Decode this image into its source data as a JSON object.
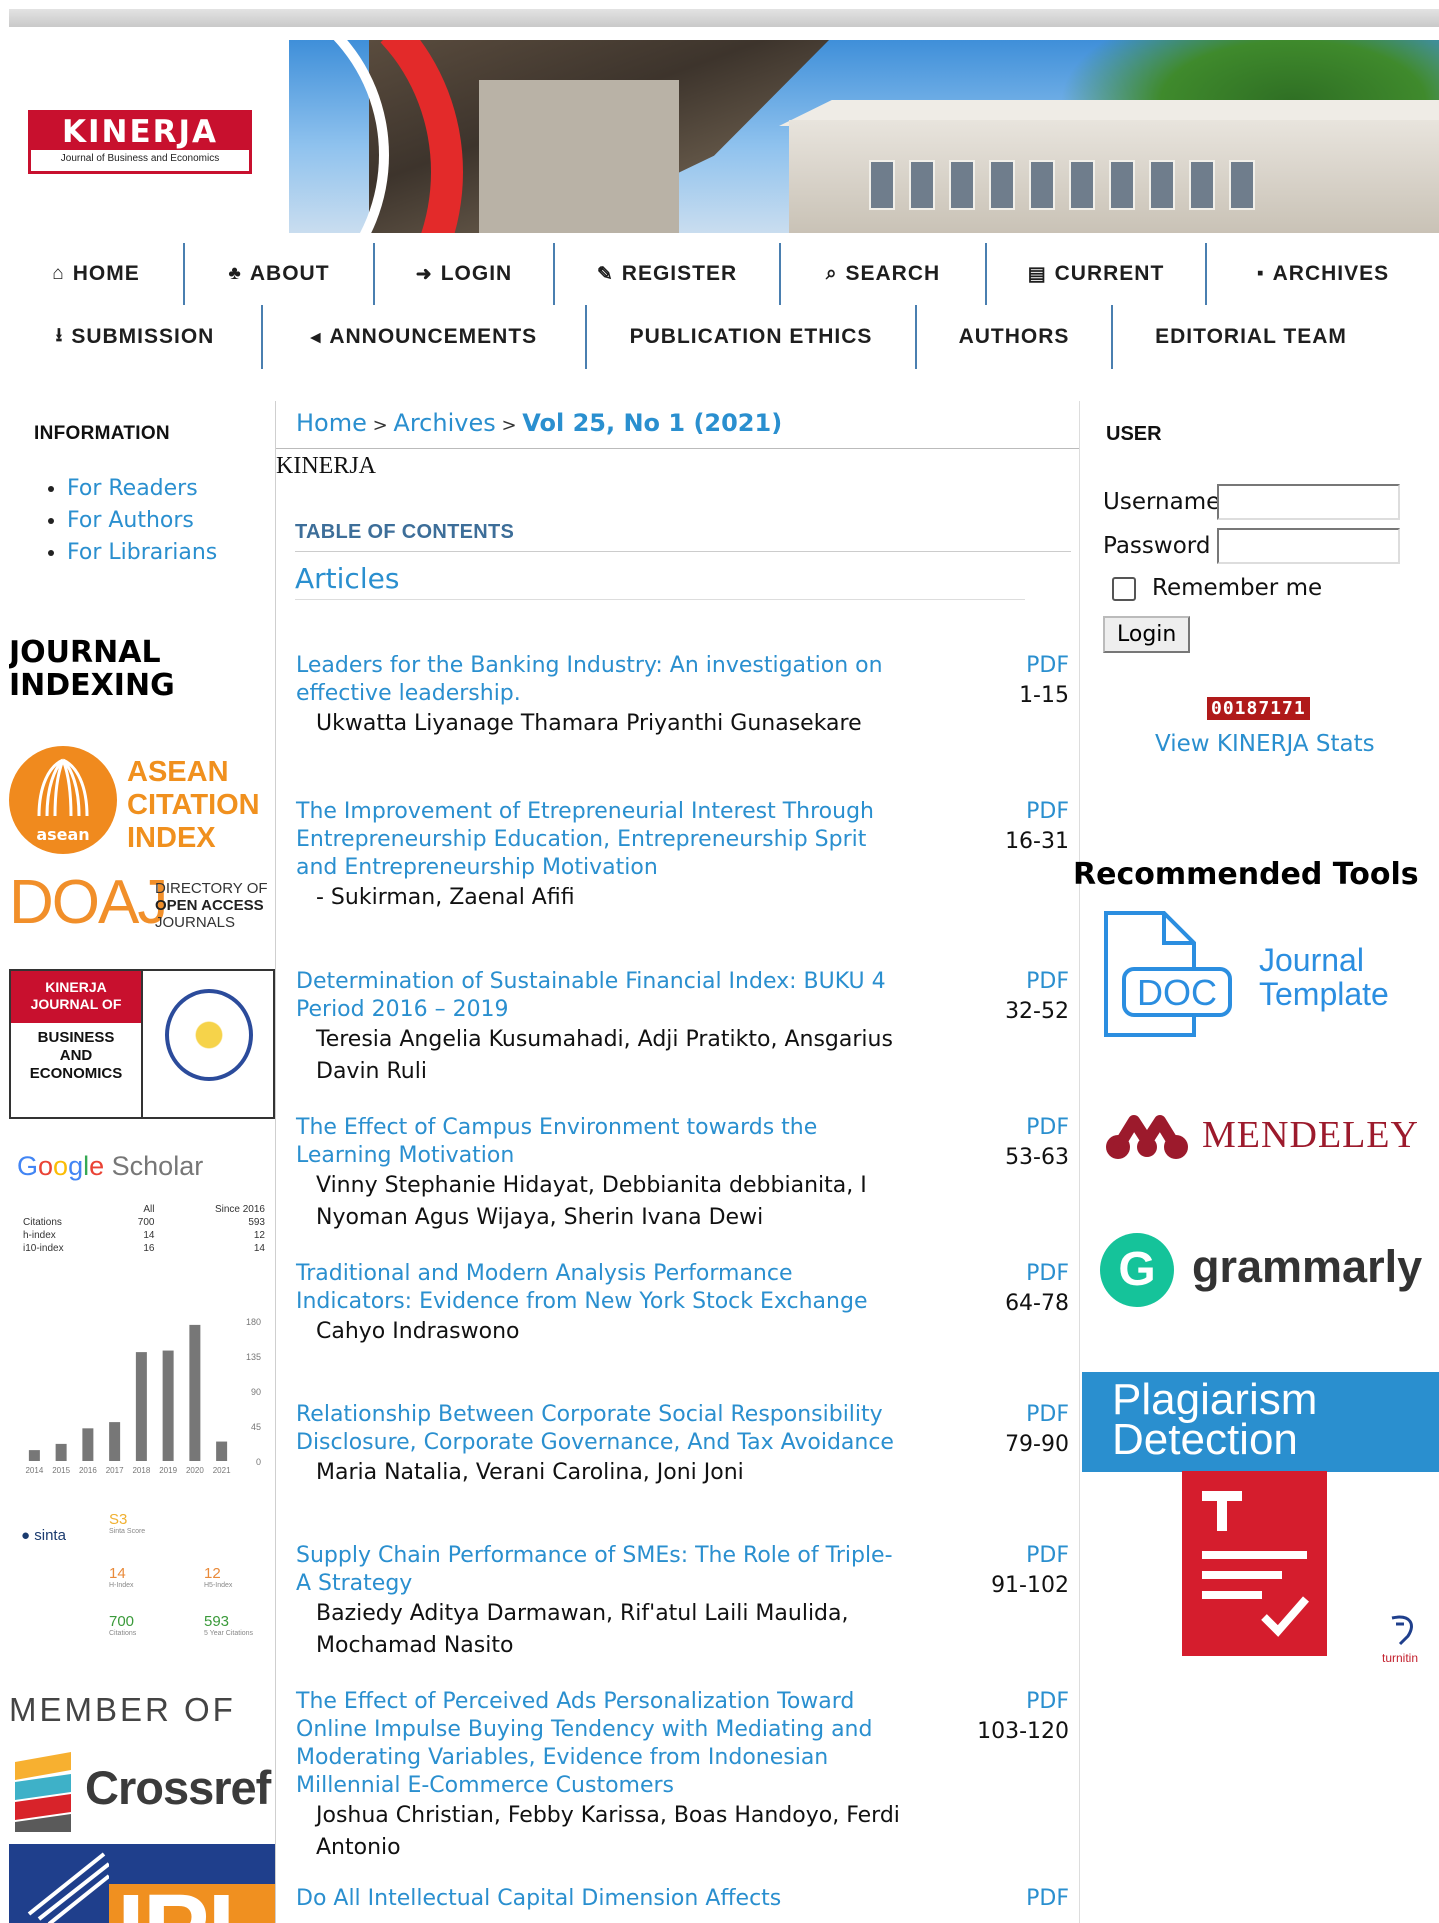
{
  "logo": {
    "title": "KINERJA",
    "subtitle": "Journal of Business and Economics"
  },
  "nav": {
    "row1": [
      {
        "icon": "⌂",
        "label": "HOME"
      },
      {
        "icon": "♣",
        "label": "ABOUT"
      },
      {
        "icon": "➜",
        "label": "LOGIN"
      },
      {
        "icon": "✎",
        "label": "REGISTER"
      },
      {
        "icon": "⌕",
        "label": "SEARCH"
      },
      {
        "icon": "▤",
        "label": "CURRENT"
      },
      {
        "icon": "▪",
        "label": "ARCHIVES"
      }
    ],
    "row2": [
      {
        "icon": "⭳",
        "label": "SUBMISSION"
      },
      {
        "icon": "◂",
        "label": "ANNOUNCEMENTS"
      },
      {
        "icon": "",
        "label": "PUBLICATION ETHICS"
      },
      {
        "icon": "",
        "label": "AUTHORS"
      },
      {
        "icon": "",
        "label": "EDITORIAL TEAM"
      }
    ]
  },
  "left": {
    "info_title": "INFORMATION",
    "info_links": [
      "For Readers",
      "For Authors",
      "For Librarians"
    ],
    "indexing_title_1": "JOURNAL",
    "indexing_title_2": "INDEXING",
    "asean": {
      "badge": "asean",
      "line1": "ASEAN",
      "line2": "CITATION",
      "line3": "INDEX"
    },
    "doaj": {
      "big": "DOAJ",
      "line1": "DIRECTORY OF",
      "line2": "OPEN ACCESS",
      "line3": "JOURNALS"
    },
    "kinerja_box": {
      "top1": "KINERJA",
      "top2": "JOURNAL OF",
      "b1": "BUSINESS",
      "b2": "AND",
      "b3": "ECONOMICS"
    },
    "scholar": {
      "brand_letters": [
        "G",
        "o",
        "o",
        "g",
        "l",
        "e"
      ],
      "brand_tail": "Scholar",
      "headers": [
        "",
        "All",
        "Since 2016"
      ],
      "rows": [
        {
          "label": "Citations",
          "all": "700",
          "since": "593"
        },
        {
          "label": "h-index",
          "all": "14",
          "since": "12"
        },
        {
          "label": "i10-index",
          "all": "16",
          "since": "14"
        }
      ]
    },
    "sinta": {
      "logo": "sinta",
      "score": "S3",
      "score_label": "Sinta Score",
      "hindex": "14",
      "hindex_label": "H-Index",
      "h5": "12",
      "h5_label": "H5-Index",
      "cites": "700",
      "cites_label": "Citations",
      "cites5": "593",
      "cites5_label": "5 Year Citations"
    },
    "member_of": "MEMBER OF",
    "crossref": "Crossref",
    "ipi": "IPI"
  },
  "chart_data": {
    "type": "bar",
    "categories": [
      "2014",
      "2015",
      "2016",
      "2017",
      "2018",
      "2019",
      "2020",
      "2021"
    ],
    "values": [
      14,
      22,
      42,
      50,
      140,
      142,
      175,
      25
    ],
    "ylim": [
      0,
      180
    ],
    "yticks": [
      0,
      45,
      90,
      135,
      180
    ],
    "color": "#777777"
  },
  "main": {
    "breadcrumb": {
      "home": "Home",
      "sep1": " > ",
      "archives": "Archives",
      "sep2": " > ",
      "current": "Vol 25, No 1 (2021)"
    },
    "journal_name": "KINERJA",
    "toc_title": "TABLE OF CONTENTS",
    "section": "Articles",
    "articles": [
      {
        "title": "Leaders for the Banking Industry: An investigation on effective leadership.",
        "authors": "Ukwatta Liyanage Thamara Priyanthi Gunasekare",
        "pdf": "PDF",
        "pages": "1-15"
      },
      {
        "title": "The Improvement of Etrepreneurial Interest Through Entrepreneurship Education, Entrepreneurship Sprit and Entrepreneurship Motivation",
        "authors": "- Sukirman, Zaenal Afifi",
        "pdf": "PDF",
        "pages": "16-31"
      },
      {
        "title": "Determination of Sustainable Financial Index: BUKU 4 Period 2016 – 2019",
        "authors": "Teresia Angelia Kusumahadi, Adji Pratikto, Ansgarius Davin Ruli",
        "pdf": "PDF",
        "pages": "32-52"
      },
      {
        "title": "The Effect of Campus Environment towards the Learning Motivation",
        "authors": "Vinny Stephanie Hidayat, Debbianita debbianita, I Nyoman Agus Wijaya, Sherin Ivana Dewi",
        "pdf": "PDF",
        "pages": "53-63"
      },
      {
        "title": "Traditional and Modern Analysis Performance Indicators: Evidence from New York Stock Exchange",
        "authors": "Cahyo Indraswono",
        "pdf": "PDF",
        "pages": "64-78"
      },
      {
        "title": "Relationship Between Corporate Social Responsibility Disclosure, Corporate Governance, And Tax Avoidance",
        "authors": "Maria Natalia, Verani Carolina, Joni Joni",
        "pdf": "PDF",
        "pages": "79-90"
      },
      {
        "title": "Supply Chain Performance of SMEs: The Role of Triple-A Strategy",
        "authors": "Baziedy Aditya Darmawan, Rif'atul Laili Maulida, Mochamad Nasito",
        "pdf": "PDF",
        "pages": "91-102"
      },
      {
        "title": "The Effect of Perceived Ads Personalization Toward Online Impulse Buying Tendency with Mediating and Moderating Variables, Evidence from Indonesian Millennial E-Commerce Customers",
        "authors": "Joshua Christian, Febby Karissa, Boas Handoyo, Ferdi Antonio",
        "pdf": "PDF",
        "pages": "103-120"
      },
      {
        "title": "Do All Intellectual Capital Dimension Affects",
        "authors": "",
        "pdf": "PDF",
        "pages": ""
      }
    ]
  },
  "right": {
    "user_title": "USER",
    "username_label": "Username",
    "password_label": "Password",
    "remember_label": "Remember me",
    "login_label": "Login",
    "counter": "00187171",
    "stats_link": "View KINERJA Stats",
    "tools_title": "Recommended Tools",
    "doc_label": "DOC",
    "jt_line1": "Journal",
    "jt_line2": "Template",
    "mendeley": "MENDELEY",
    "grammarly_g": "G",
    "grammarly": "grammarly",
    "plag_line1": "Plagiarism",
    "plag_line2": "Detection",
    "turnitin": "turnitin"
  }
}
